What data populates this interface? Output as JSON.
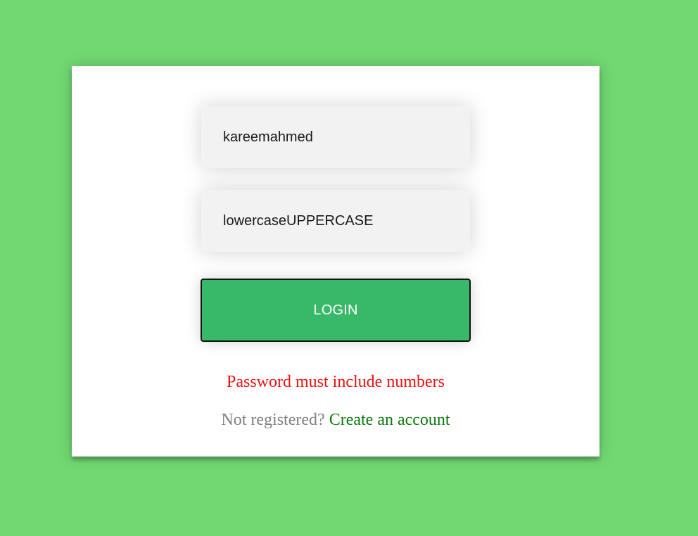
{
  "colors": {
    "page_background": "#71d872",
    "card_background": "#ffffff",
    "field_background": "#f2f2f2",
    "button_background": "#38b869",
    "error_text": "#ee1111",
    "link_text": "#0d7a0d",
    "muted_text": "#808080"
  },
  "login_form": {
    "username_value": "kareemahmed",
    "password_value": "lowercaseUPPERCASE",
    "login_button_label": "LOGIN",
    "error_message": "Password must include numbers",
    "not_registered_text": "Not registered?",
    "create_account_link": "Create an account"
  }
}
